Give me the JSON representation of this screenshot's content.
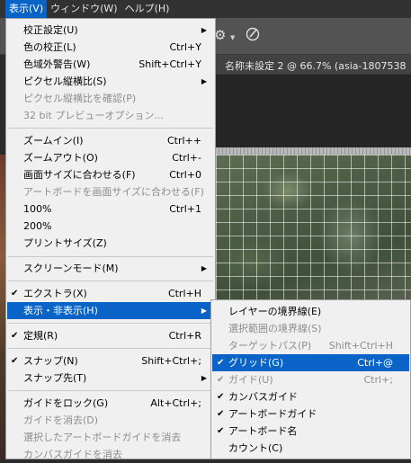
{
  "menubar": {
    "active": "表示(V)",
    "items": [
      "ウィンドウ(W)",
      "ヘルプ(H)"
    ]
  },
  "document_tab": {
    "title": "名称未設定 2 @ 66.7% (asia-1807538"
  },
  "view_menu": {
    "items": [
      {
        "label": "校正設定(U)",
        "shortcut": "",
        "submenu": true,
        "disabled": false
      },
      {
        "label": "色の校正(L)",
        "shortcut": "Ctrl+Y",
        "disabled": false
      },
      {
        "label": "色域外警告(W)",
        "shortcut": "Shift+Ctrl+Y",
        "disabled": false
      },
      {
        "label": "ピクセル縦横比(S)",
        "shortcut": "",
        "submenu": true,
        "disabled": false
      },
      {
        "label": "ピクセル縦横比を確認(P)",
        "shortcut": "",
        "disabled": true
      },
      {
        "label": "32 bit プレビューオプション...",
        "shortcut": "",
        "disabled": true
      },
      {
        "label": "ズームイン(I)",
        "shortcut": "Ctrl++",
        "disabled": false
      },
      {
        "label": "ズームアウト(O)",
        "shortcut": "Ctrl+-",
        "disabled": false
      },
      {
        "label": "画面サイズに合わせる(F)",
        "shortcut": "Ctrl+0",
        "disabled": false
      },
      {
        "label": "アートボードを画面サイズに合わせる(F)",
        "shortcut": "",
        "disabled": true
      },
      {
        "label": "100%",
        "shortcut": "Ctrl+1",
        "disabled": false
      },
      {
        "label": "200%",
        "shortcut": "",
        "disabled": false
      },
      {
        "label": "プリントサイズ(Z)",
        "shortcut": "",
        "disabled": false
      },
      {
        "label": "スクリーンモード(M)",
        "shortcut": "",
        "submenu": true,
        "disabled": false
      },
      {
        "label": "エクストラ(X)",
        "shortcut": "Ctrl+H",
        "checked": true,
        "disabled": false
      },
      {
        "label": "表示・非表示(H)",
        "shortcut": "",
        "submenu": true,
        "highlighted": true
      },
      {
        "label": "定規(R)",
        "shortcut": "Ctrl+R",
        "checked": true,
        "disabled": false
      },
      {
        "label": "スナップ(N)",
        "shortcut": "Shift+Ctrl+;",
        "checked": true,
        "disabled": false
      },
      {
        "label": "スナップ先(T)",
        "shortcut": "",
        "submenu": true,
        "disabled": false
      },
      {
        "label": "ガイドをロック(G)",
        "shortcut": "Alt+Ctrl+;",
        "disabled": false
      },
      {
        "label": "ガイドを消去(D)",
        "shortcut": "",
        "disabled": true
      },
      {
        "label": "選択したアートボードガイドを消去",
        "shortcut": "",
        "disabled": true
      },
      {
        "label": "カンバスガイドを消去",
        "shortcut": "",
        "disabled": true
      }
    ]
  },
  "show_submenu": {
    "items": [
      {
        "label": "レイヤーの境界線(E)",
        "shortcut": "",
        "disabled": false
      },
      {
        "label": "選択範囲の境界線(S)",
        "shortcut": "",
        "disabled": true
      },
      {
        "label": "ターゲットパス(P)",
        "shortcut": "Shift+Ctrl+H",
        "disabled": true
      },
      {
        "label": "グリッド(G)",
        "shortcut": "Ctrl+@",
        "checked": true,
        "highlighted": true
      },
      {
        "label": "ガイド(U)",
        "shortcut": "Ctrl+;",
        "checked": true,
        "disabled": true
      },
      {
        "label": "カンバスガイド",
        "shortcut": "",
        "checked": true,
        "disabled": false
      },
      {
        "label": "アートボードガイド",
        "shortcut": "",
        "checked": true,
        "disabled": false
      },
      {
        "label": "アートボード名",
        "shortcut": "",
        "checked": true,
        "disabled": false
      },
      {
        "label": "カウント(C)",
        "shortcut": "",
        "disabled": false
      }
    ]
  },
  "icons": {
    "check": "checkmark-icon",
    "submenu_arrow": "triangle-right-icon",
    "gear": "gear-icon",
    "brush": "brush-icon"
  },
  "colors": {
    "highlight": "#0a64c8",
    "menu_bg": "#f0f0f0",
    "disabled_text": "#8d8d8d"
  }
}
